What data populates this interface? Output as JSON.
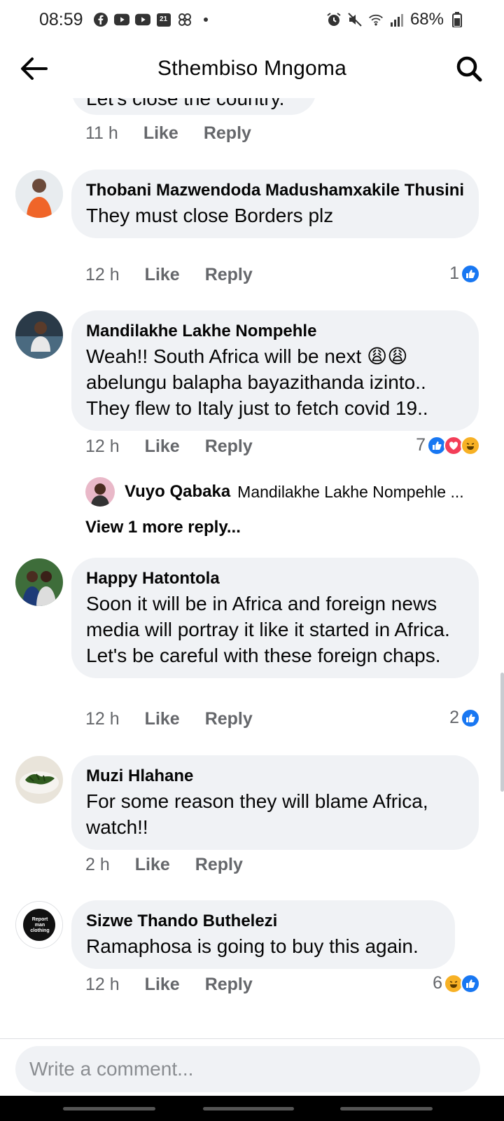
{
  "status_bar": {
    "time": "08:59",
    "battery": "68%",
    "calendar_day": "21"
  },
  "header": {
    "title": "Sthembiso Mngoma"
  },
  "colors": {
    "bubble": "#f0f2f5",
    "meta": "#65676b",
    "like_blue": "#1877f2",
    "love_red": "#f33e58",
    "haha_yellow": "#f7b125"
  },
  "partial_comment": {
    "text": "Let's close the country.",
    "time": "11 h",
    "like_label": "Like",
    "reply_label": "Reply"
  },
  "comments": [
    {
      "author": "Thobani Mazwendoda Madushamxakile Thusini",
      "text": "They must close Borders plz",
      "time": "12 h",
      "like_label": "Like",
      "reply_label": "Reply",
      "reaction_count": "1",
      "reactions": [
        "like"
      ]
    },
    {
      "author": "Mandilakhe Lakhe Nompehle",
      "text": "Weah!! South Africa will be next 😩😩 abelungu balapha bayazithanda izinto.. They flew to Italy just to fetch covid 19..",
      "time": "12 h",
      "like_label": "Like",
      "reply_label": "Reply",
      "reaction_count": "7",
      "reactions": [
        "like",
        "love",
        "haha"
      ],
      "reply_preview": {
        "author": "Vuyo Qabaka",
        "text": "Mandilakhe Lakhe Nompehle ..."
      },
      "more_replies": "View 1 more reply..."
    },
    {
      "author": "Happy Hatontola",
      "text": "Soon it will be in Africa and foreign news media will portray it like it started in Africa. Let's be careful with these foreign chaps.",
      "time": "12 h",
      "like_label": "Like",
      "reply_label": "Reply",
      "reaction_count": "2",
      "reactions": [
        "like"
      ]
    },
    {
      "author": "Muzi Hlahane",
      "text": "For some reason they will blame Africa, watch!!",
      "time": "2 h",
      "like_label": "Like",
      "reply_label": "Reply",
      "reaction_count": "",
      "reactions": []
    },
    {
      "author": "Sizwe Thando Buthelezi",
      "avatar_logo": "Report man clothing",
      "text": "Ramaphosa is going to buy this again.",
      "time": "12 h",
      "like_label": "Like",
      "reply_label": "Reply",
      "reaction_count": "6",
      "reactions": [
        "haha",
        "like"
      ]
    }
  ],
  "composer": {
    "placeholder": "Write a comment..."
  }
}
